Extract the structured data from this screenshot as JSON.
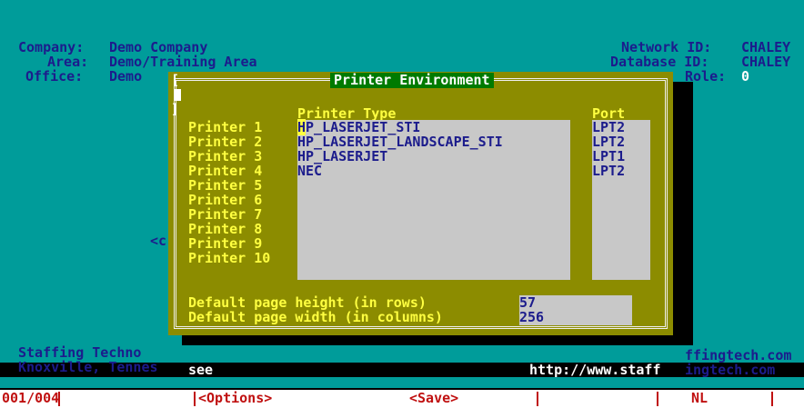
{
  "header": {
    "company_label": "Company:",
    "company_value": "Demo Company",
    "area_label": "Area:",
    "area_value": "Demo/Training Area",
    "office_label": "Office:",
    "office_value": "Demo",
    "network_label": "Network ID:",
    "network_value": "CHALEY",
    "database_label": "Database ID:",
    "database_value": "CHALEY",
    "role_label": "Role:",
    "role_value": "0"
  },
  "background_fragment": "<c",
  "dialog": {
    "title": "Printer Environment",
    "close_icon": "close-box-icon",
    "printer_type_header": "Printer Type",
    "port_header": "Port",
    "printers": [
      {
        "label": "Printer 1",
        "type": "HP_LASERJET_STI",
        "port": "LPT2"
      },
      {
        "label": "Printer 2",
        "type": "HP_LASERJET_LANDSCAPE_STI",
        "port": "LPT2"
      },
      {
        "label": "Printer 3",
        "type": "HP_LASERJET",
        "port": "LPT1"
      },
      {
        "label": "Printer 4",
        "type": "NEC",
        "port": "LPT2"
      },
      {
        "label": "Printer 5",
        "type": "",
        "port": ""
      },
      {
        "label": "Printer 6",
        "type": "",
        "port": ""
      },
      {
        "label": "Printer 7",
        "type": "",
        "port": ""
      },
      {
        "label": "Printer 8",
        "type": "",
        "port": ""
      },
      {
        "label": "Printer 9",
        "type": "",
        "port": ""
      },
      {
        "label": "Printer 10",
        "type": "",
        "port": ""
      }
    ],
    "page_height_label": "Default page height (in rows)",
    "page_height_value": "57",
    "page_width_label": "Default page width (in columns)",
    "page_width_value": "256"
  },
  "footer": {
    "line1_left": "Staffing Techno",
    "line1_right": "ffingtech.com",
    "line2_left": "Knoxville, Tennes",
    "line2_left_cont": "see",
    "url_prefix": "http://www.staff",
    "url_suffix": "ingtech.com"
  },
  "status_bar": {
    "record": "001/004",
    "options": "<Options>",
    "save": "<Save>",
    "mode": "NL"
  },
  "colors": {
    "background": "#009c9a",
    "dialog": "#8c8c00",
    "title_bar": "#007a00",
    "label_yellow": "#ffff40",
    "text_navy": "#1c1c8c",
    "list_bg": "#c8c8c8",
    "status_text": "#c01010"
  }
}
